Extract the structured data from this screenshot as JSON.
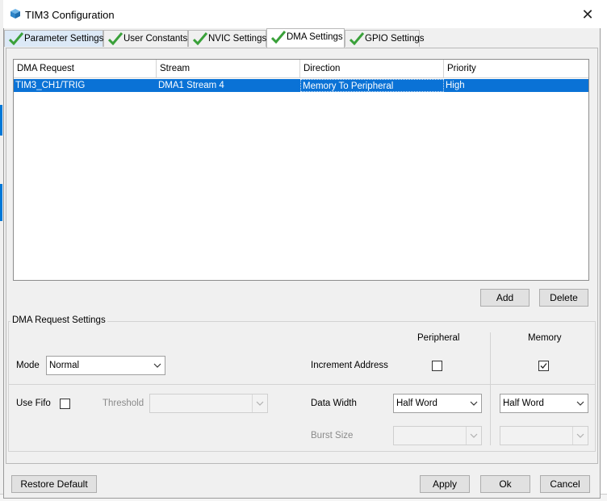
{
  "window": {
    "title": "TIM3 Configuration"
  },
  "tabs": [
    {
      "label": "Parameter Settings",
      "active": false
    },
    {
      "label": "User Constants",
      "active": false
    },
    {
      "label": "NVIC Settings",
      "active": false
    },
    {
      "label": "DMA Settings",
      "active": true
    },
    {
      "label": "GPIO Settings",
      "active": false
    }
  ],
  "dma_table": {
    "columns": [
      "DMA Request",
      "Stream",
      "Direction",
      "Priority"
    ],
    "rows": [
      {
        "request": "TIM3_CH1/TRIG",
        "stream": "DMA1 Stream 4",
        "direction": "Memory To Peripheral",
        "priority": "High",
        "selected": true
      }
    ]
  },
  "table_buttons": {
    "add": "Add",
    "delete": "Delete"
  },
  "settings": {
    "group_title": "DMA Request Settings",
    "peripheral_header": "Peripheral",
    "memory_header": "Memory",
    "mode_label": "Mode",
    "mode_value": "Normal",
    "increment_label": "Increment Address",
    "increment_peripheral": false,
    "increment_memory": true,
    "fifo_label": "Use Fifo",
    "use_fifo": false,
    "threshold_label": "Threshold",
    "threshold_value": "",
    "data_width_label": "Data Width",
    "data_width_peripheral": "Half Word",
    "data_width_memory": "Half Word",
    "burst_label": "Burst Size",
    "burst_peripheral": "",
    "burst_memory": ""
  },
  "footer": {
    "restore": "Restore Default",
    "apply": "Apply",
    "ok": "Ok",
    "cancel": "Cancel"
  },
  "colors": {
    "selection": "#0a72d6",
    "check": "#3aa13a",
    "dialog_bg": "#f0f0f0"
  },
  "icons": {
    "title": "cube-icon",
    "tab": "check-icon",
    "close": "close-icon",
    "combo": "chevron-down-icon"
  }
}
